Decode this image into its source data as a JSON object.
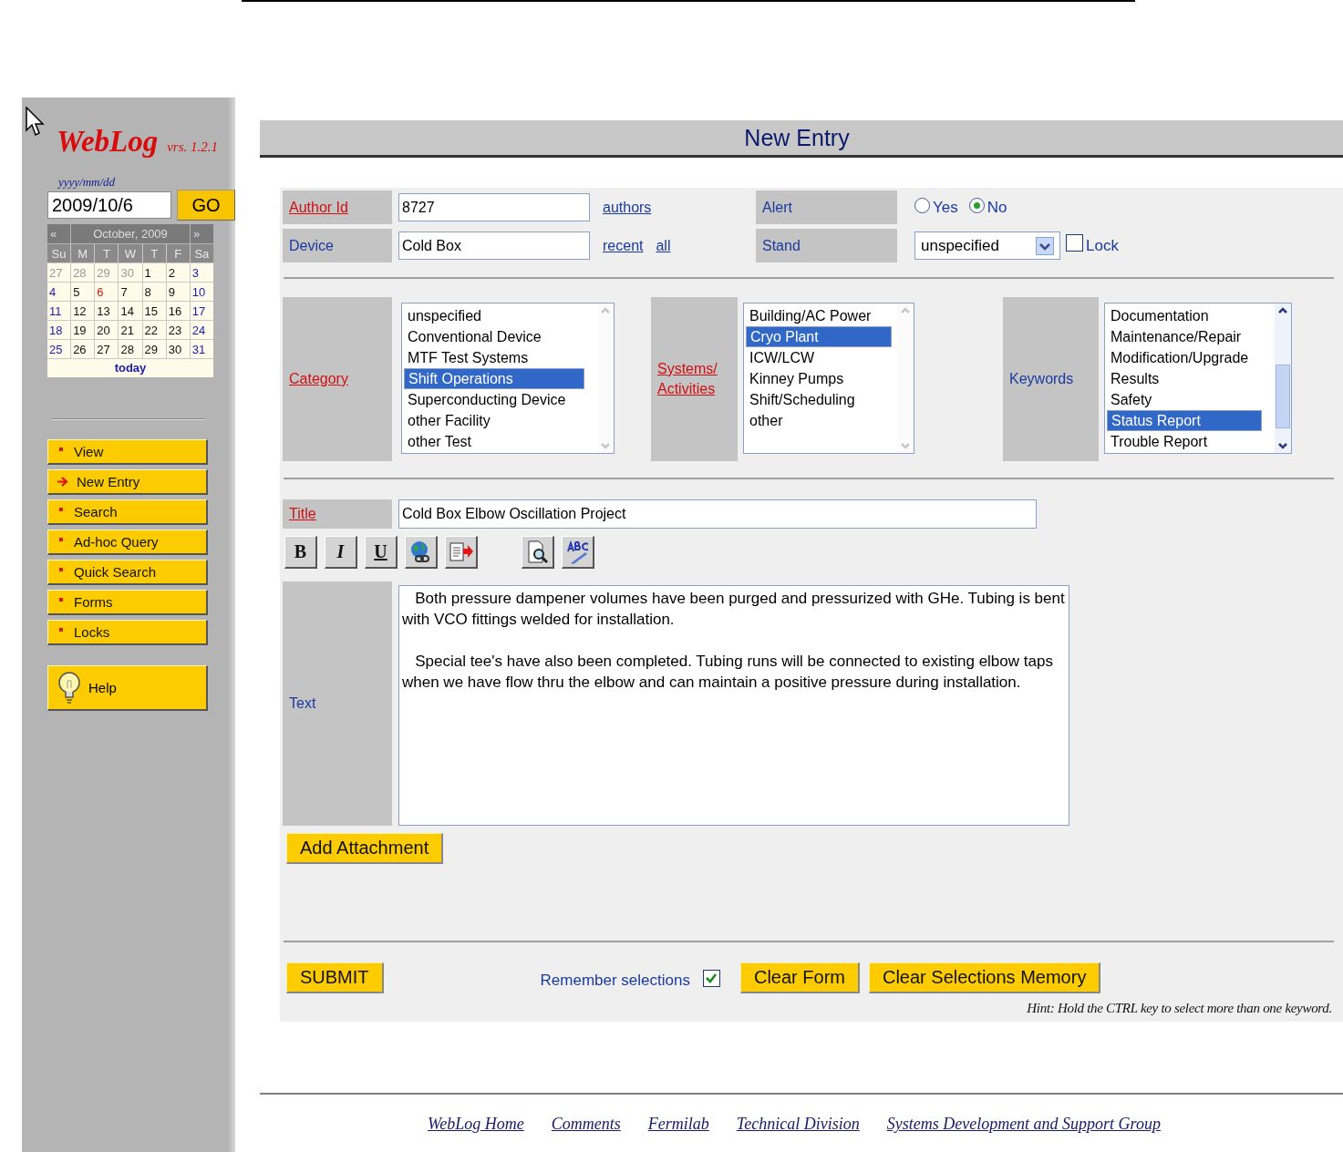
{
  "sidebar": {
    "logo": "WebLog",
    "version": "vrs. 1.2.1",
    "date_hint": "yyyy/mm/dd",
    "date_value": "2009/10/6",
    "go_button": "GO",
    "calendar": {
      "prev": "«",
      "month": "October, 2009",
      "next": "»",
      "weekdays": [
        "Su",
        "M",
        "T",
        "W",
        "T",
        "F",
        "Sa"
      ],
      "weeks": [
        [
          {
            "d": "27",
            "kind": "other",
            "selected": false
          },
          {
            "d": "28",
            "kind": "other",
            "selected": false
          },
          {
            "d": "29",
            "kind": "other",
            "selected": false
          },
          {
            "d": "30",
            "kind": "other",
            "selected": false
          },
          {
            "d": "1",
            "kind": "weekday",
            "selected": false
          },
          {
            "d": "2",
            "kind": "weekday",
            "selected": false
          },
          {
            "d": "3",
            "kind": "weekend",
            "selected": false
          }
        ],
        [
          {
            "d": "4",
            "kind": "weekend",
            "selected": false
          },
          {
            "d": "5",
            "kind": "weekday",
            "selected": false
          },
          {
            "d": "6",
            "kind": "weekday",
            "selected": true
          },
          {
            "d": "7",
            "kind": "weekday",
            "selected": false
          },
          {
            "d": "8",
            "kind": "weekday",
            "selected": false
          },
          {
            "d": "9",
            "kind": "weekday",
            "selected": false
          },
          {
            "d": "10",
            "kind": "weekend",
            "selected": false
          }
        ],
        [
          {
            "d": "11",
            "kind": "weekend",
            "selected": false
          },
          {
            "d": "12",
            "kind": "weekday",
            "selected": false
          },
          {
            "d": "13",
            "kind": "weekday",
            "selected": false
          },
          {
            "d": "14",
            "kind": "weekday",
            "selected": false
          },
          {
            "d": "15",
            "kind": "weekday",
            "selected": false
          },
          {
            "d": "16",
            "kind": "weekday",
            "selected": false
          },
          {
            "d": "17",
            "kind": "weekend",
            "selected": false
          }
        ],
        [
          {
            "d": "18",
            "kind": "weekend",
            "selected": false
          },
          {
            "d": "19",
            "kind": "weekday",
            "selected": false
          },
          {
            "d": "20",
            "kind": "weekday",
            "selected": false
          },
          {
            "d": "21",
            "kind": "weekday",
            "selected": false
          },
          {
            "d": "22",
            "kind": "weekday",
            "selected": false
          },
          {
            "d": "23",
            "kind": "weekday",
            "selected": false
          },
          {
            "d": "24",
            "kind": "weekend",
            "selected": false
          }
        ],
        [
          {
            "d": "25",
            "kind": "weekend",
            "selected": false
          },
          {
            "d": "26",
            "kind": "weekday",
            "selected": false
          },
          {
            "d": "27",
            "kind": "weekday",
            "selected": false
          },
          {
            "d": "28",
            "kind": "weekday",
            "selected": false
          },
          {
            "d": "29",
            "kind": "weekday",
            "selected": false
          },
          {
            "d": "30",
            "kind": "weekday",
            "selected": false
          },
          {
            "d": "31",
            "kind": "weekend",
            "selected": false
          }
        ]
      ],
      "today": "today"
    },
    "nav": [
      {
        "label": "View",
        "selected": false
      },
      {
        "label": "New Entry",
        "selected": true
      },
      {
        "label": "Search",
        "selected": false
      },
      {
        "label": "Ad-hoc Query",
        "selected": false
      },
      {
        "label": "Quick Search",
        "selected": false
      },
      {
        "label": "Forms",
        "selected": false
      },
      {
        "label": "Locks",
        "selected": false
      }
    ],
    "help": "Help"
  },
  "heading": "New Entry",
  "form": {
    "author_label": "Author Id",
    "author_value": "8727",
    "authors_link": "authors",
    "device_label": "Device",
    "device_value": "Cold Box",
    "device_links": [
      "recent",
      "all"
    ],
    "alert_label": "Alert",
    "alert_options": [
      {
        "label": "Yes",
        "selected": false
      },
      {
        "label": "No",
        "selected": true
      }
    ],
    "stand_label": "Stand",
    "stand_value": "unspecified",
    "lock": {
      "label": "Lock",
      "checked": false
    },
    "lists": [
      {
        "label": "Category",
        "link": true,
        "items": [
          {
            "text": "unspecified",
            "selected": false
          },
          {
            "text": "Conventional Device",
            "selected": false
          },
          {
            "text": "MTF Test Systems",
            "selected": false
          },
          {
            "text": "Shift Operations",
            "selected": true
          },
          {
            "text": "Superconducting Device",
            "selected": false
          },
          {
            "text": "other Facility",
            "selected": false
          },
          {
            "text": "other Test",
            "selected": false
          }
        ]
      },
      {
        "label": "Systems/ Activities",
        "link": true,
        "items": [
          {
            "text": "Building/AC Power",
            "selected": false
          },
          {
            "text": "Cryo Plant",
            "selected": true
          },
          {
            "text": "ICW/LCW",
            "selected": false
          },
          {
            "text": "Kinney Pumps",
            "selected": false
          },
          {
            "text": "Shift/Scheduling",
            "selected": false
          },
          {
            "text": "other",
            "selected": false
          }
        ]
      },
      {
        "label": "Keywords",
        "link": false,
        "items": [
          {
            "text": "Documentation",
            "selected": false
          },
          {
            "text": "Maintenance/Repair",
            "selected": false
          },
          {
            "text": "Modification/Upgrade",
            "selected": false
          },
          {
            "text": "Results",
            "selected": false
          },
          {
            "text": "Safety",
            "selected": false
          },
          {
            "text": "Status Report",
            "selected": true
          },
          {
            "text": "Trouble Report",
            "selected": false
          }
        ]
      }
    ],
    "title_label": "Title",
    "title_value": "Cold Box Elbow Oscillation Project",
    "format_buttons": [
      "B",
      "I",
      "U"
    ],
    "text_label": "Text",
    "text_paragraphs": [
      "   Both pressure dampener volumes have been purged and pressurized with GHe. Tubing is bent with VCO fittings welded for installation.",
      "   Special tee's have also been completed. Tubing runs will be connected to existing elbow taps when we have flow thru the elbow and can maintain a positive pressure during installation."
    ],
    "attach_button": "Add Attachment",
    "submit_button": "SUBMIT",
    "remember": {
      "label": "Remember selections",
      "checked": true
    },
    "clear_form_button": "Clear Form",
    "clear_memory_button": "Clear Selections Memory",
    "hint": "Hint: Hold the CTRL key to select more than one keyword."
  },
  "footer_links": [
    "WebLog Home",
    "Comments",
    "Fermilab",
    "Technical Division",
    "Systems Development and Support Group"
  ]
}
